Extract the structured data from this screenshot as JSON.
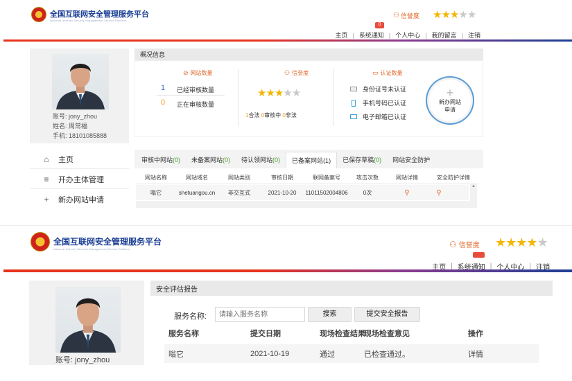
{
  "top": {
    "site_title": "全国互联网安全管理服务平台",
    "site_subtitle": "National Internet Security Management Service Platform",
    "credit_label": "信誉度",
    "stars_on": 3,
    "stars_total": 5,
    "nav": [
      "主页",
      "系统通知",
      "个人中心",
      "我的留言",
      "注销"
    ],
    "notice_badge": "0"
  },
  "profile": {
    "account": "账号: jony_zhou",
    "name": "姓名: 周常福",
    "phone": "手机: 18101085888"
  },
  "overview": {
    "title": "概况信息",
    "site_count": {
      "head": "网站数量",
      "rows": [
        {
          "num": "1",
          "label": "已经审核数量"
        },
        {
          "num": "0",
          "label": "正在审核数量"
        }
      ]
    },
    "credit": {
      "head": "信誉度",
      "stars_on": 3,
      "legal_num": "1",
      "legal": "合法",
      "review_num": "0",
      "review": "审核中",
      "illegal_num": "0",
      "illegal": "非法"
    },
    "auth": {
      "head": "认证数量",
      "items": [
        "身份证号未认证",
        "手机号码已认证",
        "电子邮箱已认证"
      ]
    },
    "new_site_button": "新办网站申请"
  },
  "sidenav": [
    {
      "label": "主页",
      "icon": "home-icon"
    },
    {
      "label": "开办主体管理",
      "icon": "list-icon"
    },
    {
      "label": "新办网站申请",
      "icon": "plus-icon"
    }
  ],
  "tabs": [
    {
      "label": "审核中网站",
      "count": "(0)"
    },
    {
      "label": "未备案网站",
      "count": "(0)"
    },
    {
      "label": "待认领网站",
      "count": "(0)"
    },
    {
      "label": "已备案网站",
      "count": "(1)"
    },
    {
      "label": "已保存草稿",
      "count": "(0)"
    },
    {
      "label": "网站安全防护",
      "count": ""
    }
  ],
  "sites_table": {
    "headers": [
      "网站名称",
      "网站域名",
      "网站类别",
      "审核日期",
      "联网备案号",
      "攻击次数",
      "网站详情",
      "安全防护详情"
    ],
    "row": [
      "嗡它",
      "shetuangou.cn",
      "非交互式",
      "2021-10-20",
      "11011502004806",
      "0次"
    ]
  },
  "bottom": {
    "site_title": "全国互联网安全管理服务平台",
    "site_subtitle": "National Internet Security Management Service Platform",
    "credit_label": "信誉度",
    "stars_on": 4,
    "nav": [
      "主页",
      "系统通知",
      "个人中心",
      "注销"
    ],
    "account": "账号: jony_zhou",
    "report_title": "安全评估报告",
    "service_name_label": "服务名称:",
    "service_placeholder": "请输入服务名称",
    "search_button": "搜索",
    "submit_button": "提交安全报告",
    "table_headers": [
      "服务名称",
      "提交日期",
      "现场检查结果",
      "现场检查意见",
      "操作"
    ],
    "table_row": [
      "嗡它",
      "2021-10-19",
      "通过",
      "已检查通过。",
      "详情"
    ]
  }
}
